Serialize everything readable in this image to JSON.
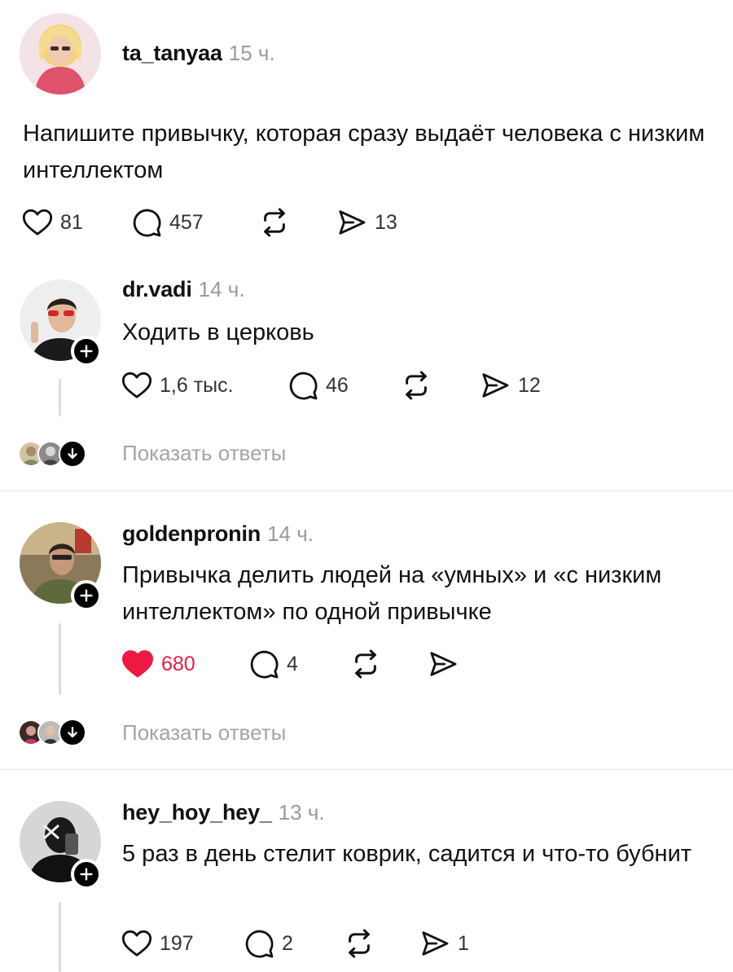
{
  "post": {
    "username": "ta_tanyaa",
    "time": "15 ч.",
    "text": "Напишите привычку, которая сразу выдаёт человека с низким интеллектом",
    "likes": "81",
    "comments": "457",
    "shares": "13"
  },
  "replies": [
    {
      "username": "dr.vadi",
      "time": "14 ч.",
      "text": "Ходить в церковь",
      "likes": "1,6 тыс.",
      "comments": "46",
      "shares": "12",
      "liked": false,
      "show_replies": "Показать ответы"
    },
    {
      "username": "goldenpronin",
      "time": "14 ч.",
      "text": "Привычка делить людей на «умных» и «с низким интеллектом» по одной привычке",
      "likes": "680",
      "comments": "4",
      "shares": "",
      "liked": true,
      "show_replies": "Показать ответы"
    },
    {
      "username": "hey_hoy_hey_",
      "time": "13 ч.",
      "text": "5 раз в день стелит коврик, садится и что-то бубнит",
      "likes": "197",
      "comments": "2",
      "shares": "1",
      "liked": false
    }
  ],
  "colors": {
    "like_active": "#ee1a44",
    "muted_text": "#9a9a9a"
  }
}
